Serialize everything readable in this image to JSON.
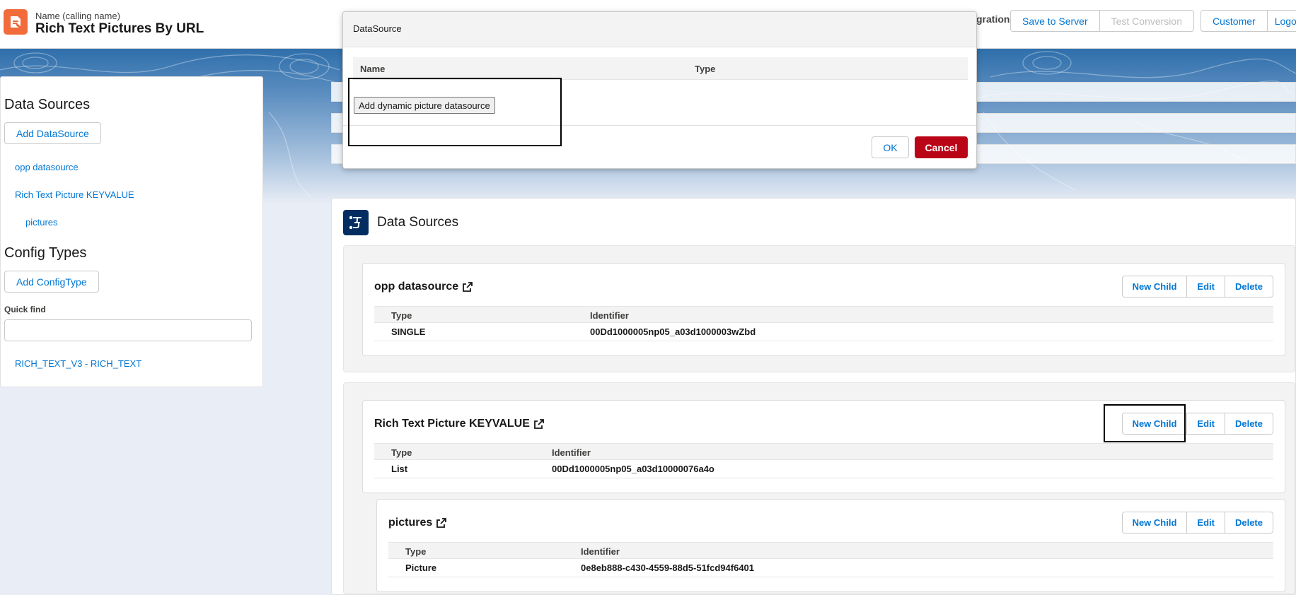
{
  "header": {
    "record_label": "Name (calling name)",
    "record_title": "Rich Text Pictures By URL",
    "partial_text": "gration",
    "buttons": {
      "save_to_server": "Save to Server",
      "test_conversion": "Test Conversion",
      "customer": "Customer",
      "logout": "Logo"
    }
  },
  "sidebar": {
    "data_sources_heading": "Data Sources",
    "add_datasource": "Add DataSource",
    "datasource_links": [
      "opp datasource",
      "Rich Text Picture KEYVALUE",
      "pictures"
    ],
    "config_types_heading": "Config Types",
    "add_configtype": "Add ConfigType",
    "quick_find_label": "Quick find",
    "quick_find_value": "",
    "config_links": [
      "RICH_TEXT_V3 - RICH_TEXT"
    ]
  },
  "main": {
    "title": "Data Sources",
    "column_type": "Type",
    "column_identifier": "Identifier",
    "actions": {
      "new_child": "New Child",
      "edit": "Edit",
      "delete": "Delete"
    },
    "cards": [
      {
        "name": "opp datasource",
        "type": "SINGLE",
        "identifier": "00Dd1000005np05_a03d1000003wZbd"
      },
      {
        "name": "Rich Text Picture KEYVALUE",
        "type": "List",
        "identifier": "00Dd1000005np05_a03d10000076a4o"
      },
      {
        "name": "pictures",
        "type": "Picture",
        "identifier": "0e8eb888-c430-4559-88d5-51fcd94f6401"
      }
    ]
  },
  "modal": {
    "title": "DataSource",
    "column_name": "Name",
    "column_type": "Type",
    "add_button": "Add dynamic picture datasource",
    "ok": "OK",
    "cancel": "Cancel"
  },
  "colors": {
    "brand_blue": "#0176d3",
    "cancel_red": "#ba0517",
    "app_orange": "#f26b3a",
    "icon_navy": "#032d60"
  }
}
